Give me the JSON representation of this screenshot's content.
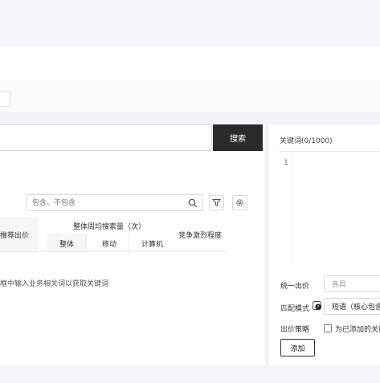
{
  "search": {
    "button_label": "搜索"
  },
  "filter": {
    "placeholder": "包含、不包含"
  },
  "table": {
    "col_recommended_bid": "推荐出价",
    "group_header": "整体周均搜索量（次）",
    "sub_overall": "整体",
    "sub_mobile": "移动",
    "sub_computer": "计算机",
    "col_competition": "竞争激烈程度",
    "empty_text": "框中输入业务相关词以获取关键词"
  },
  "keyword_panel": {
    "title": "关键词(0/1000)",
    "line_number": "1",
    "unified_bid_label": "统一出价",
    "unified_bid_value": "各异",
    "match_mode_label": "匹配模式",
    "match_mode_value": "短语（核心包含）",
    "bid_strategy_label": "出价策略",
    "bid_strategy_checkbox_label": "为已添加的关键词",
    "add_button": "添加"
  },
  "icons": [
    "search-icon",
    "filter-icon",
    "settings-icon",
    "help-icon"
  ],
  "colors": {
    "primary_button": "#2b2b2b",
    "page_bg": "#f4f5f7",
    "border": "#d9d9d9"
  }
}
